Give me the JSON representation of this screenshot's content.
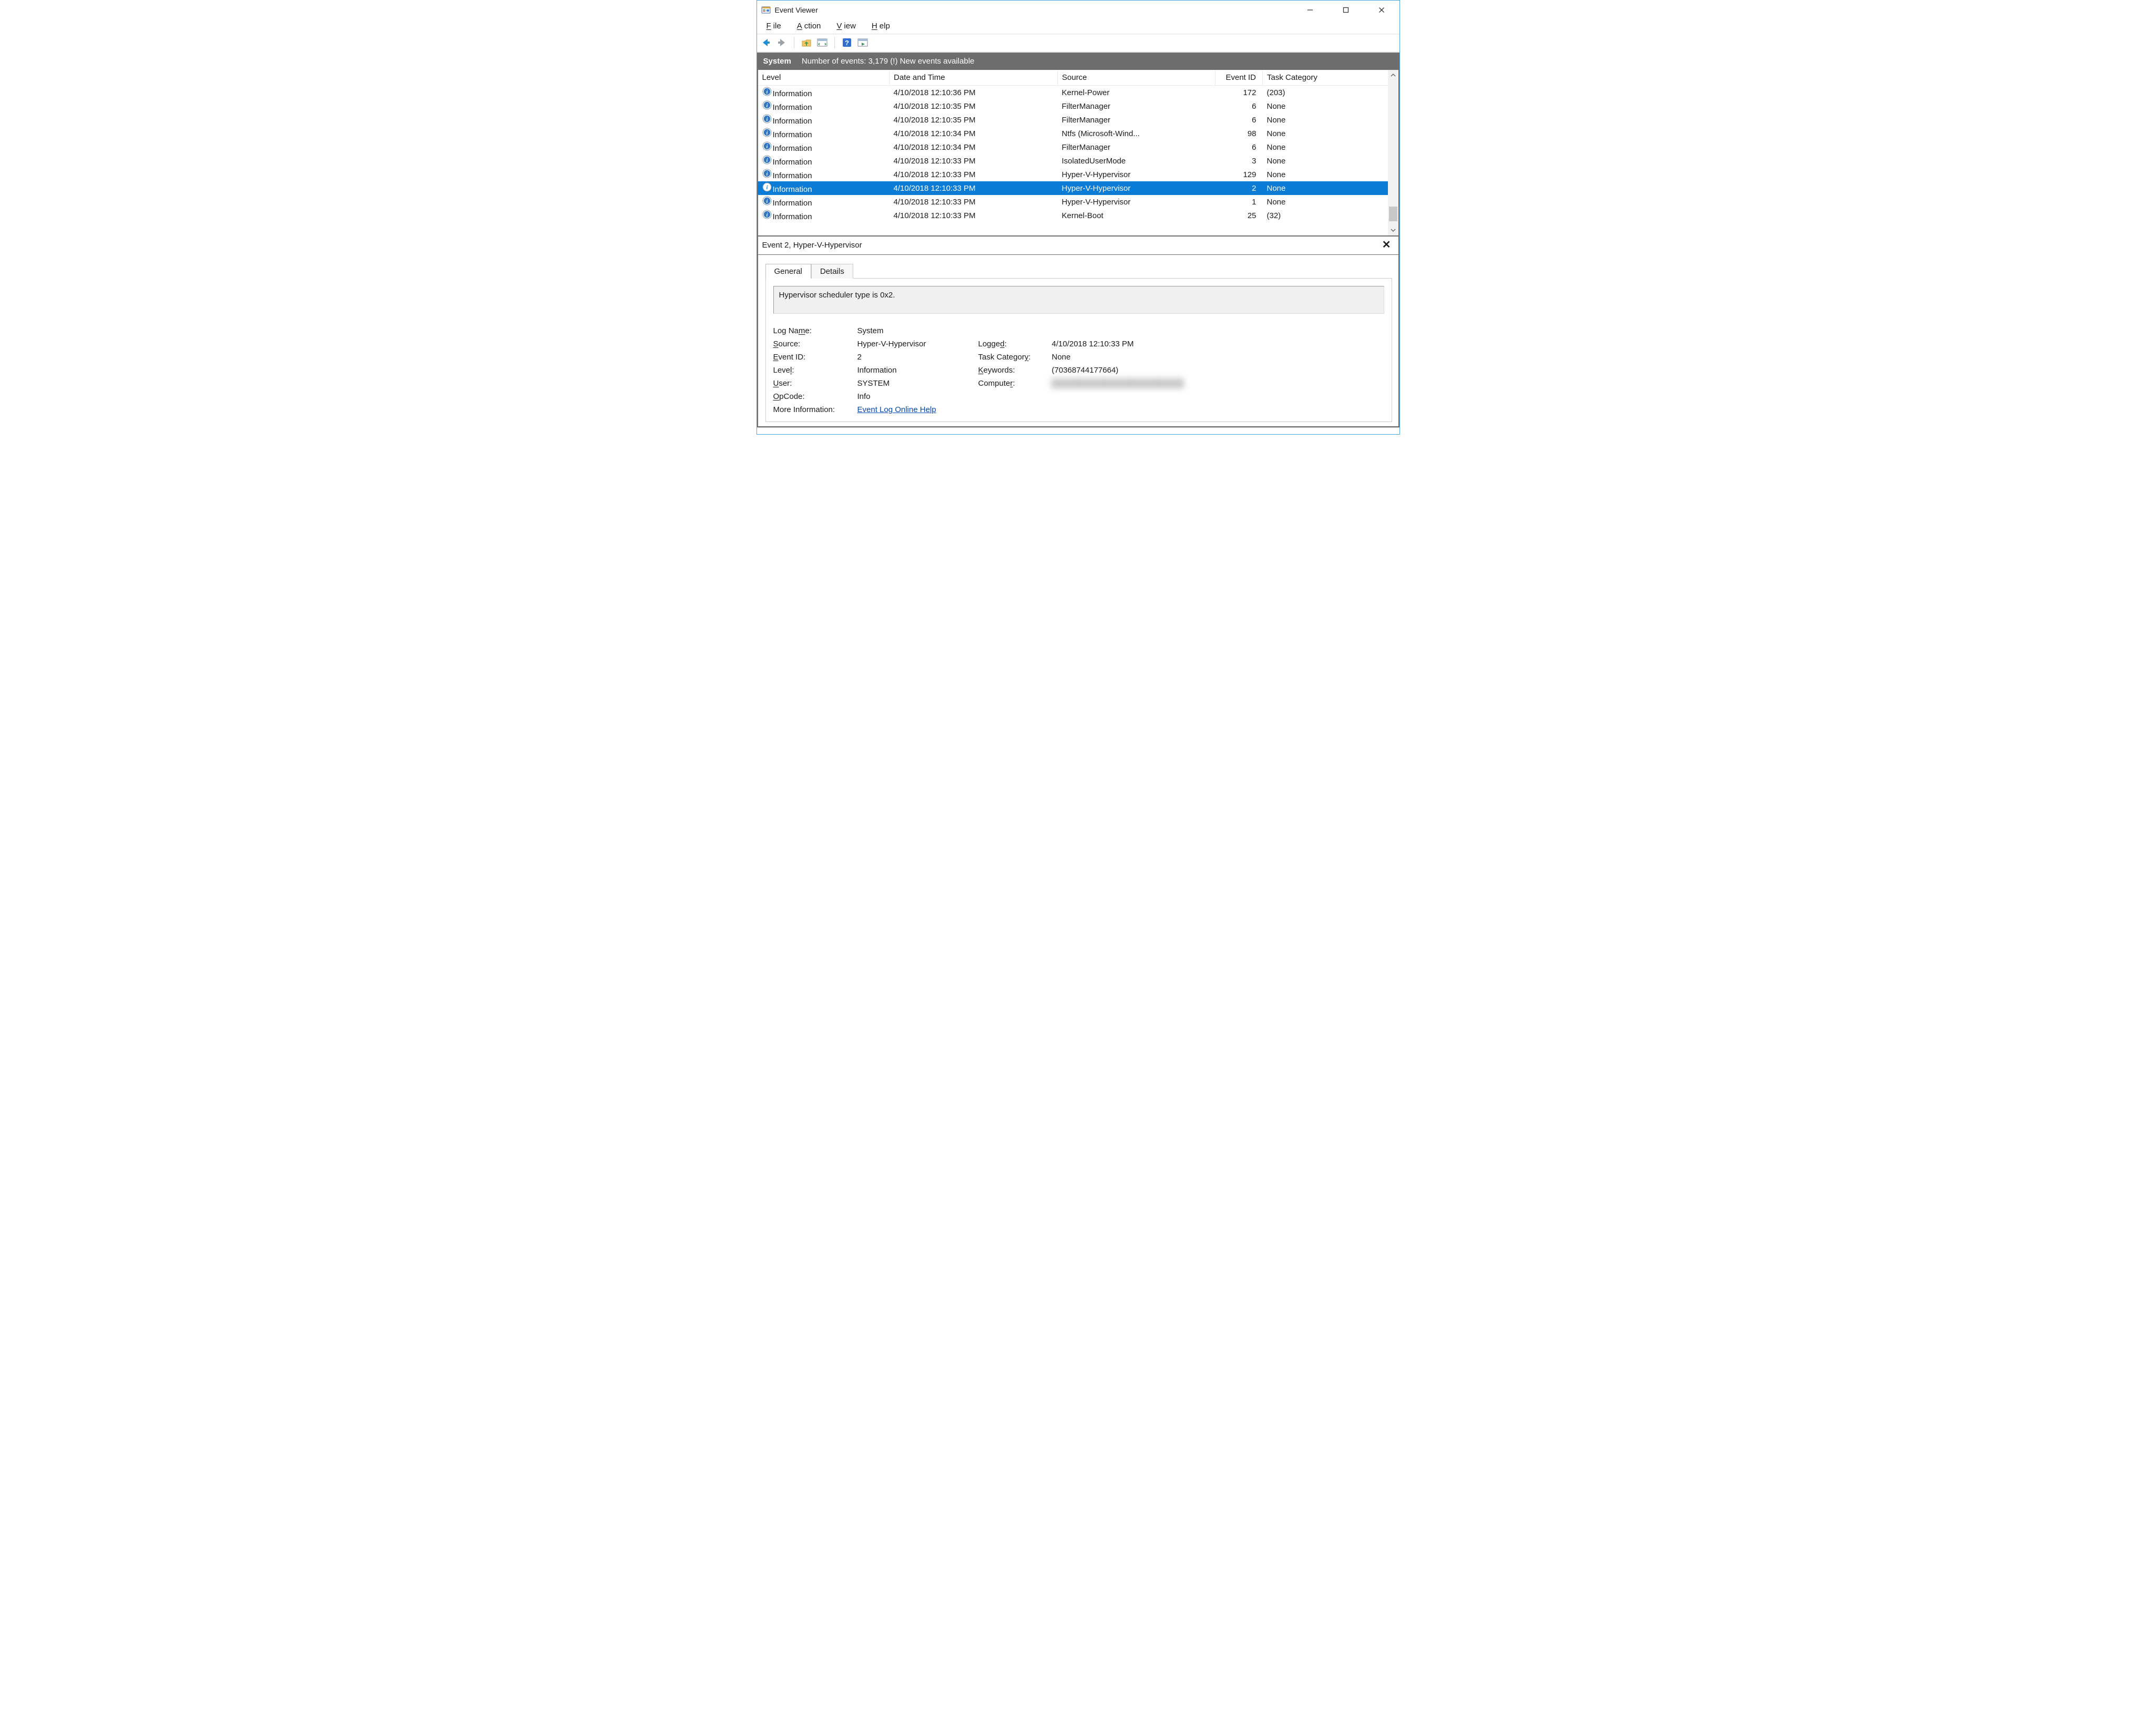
{
  "window": {
    "title": "Event Viewer"
  },
  "menubar": {
    "file": "File",
    "file_u": "F",
    "action": "Action",
    "action_u": "A",
    "view": "View",
    "view_u": "V",
    "help": "Help",
    "help_u": "H"
  },
  "log_header": {
    "name": "System",
    "status": "Number of events: 3,179 (!) New events available"
  },
  "columns": {
    "level": "Level",
    "date": "Date and Time",
    "source": "Source",
    "event_id": "Event ID",
    "task_cat": "Task Category"
  },
  "events": [
    {
      "level": "Information",
      "date": "4/10/2018 12:10:36 PM",
      "source": "Kernel-Power",
      "id": "172",
      "task": "(203)"
    },
    {
      "level": "Information",
      "date": "4/10/2018 12:10:35 PM",
      "source": "FilterManager",
      "id": "6",
      "task": "None"
    },
    {
      "level": "Information",
      "date": "4/10/2018 12:10:35 PM",
      "source": "FilterManager",
      "id": "6",
      "task": "None"
    },
    {
      "level": "Information",
      "date": "4/10/2018 12:10:34 PM",
      "source": "Ntfs (Microsoft-Wind...",
      "id": "98",
      "task": "None"
    },
    {
      "level": "Information",
      "date": "4/10/2018 12:10:34 PM",
      "source": "FilterManager",
      "id": "6",
      "task": "None"
    },
    {
      "level": "Information",
      "date": "4/10/2018 12:10:33 PM",
      "source": "IsolatedUserMode",
      "id": "3",
      "task": "None"
    },
    {
      "level": "Information",
      "date": "4/10/2018 12:10:33 PM",
      "source": "Hyper-V-Hypervisor",
      "id": "129",
      "task": "None"
    },
    {
      "level": "Information",
      "date": "4/10/2018 12:10:33 PM",
      "source": "Hyper-V-Hypervisor",
      "id": "2",
      "task": "None",
      "selected": true
    },
    {
      "level": "Information",
      "date": "4/10/2018 12:10:33 PM",
      "source": "Hyper-V-Hypervisor",
      "id": "1",
      "task": "None"
    },
    {
      "level": "Information",
      "date": "4/10/2018 12:10:33 PM",
      "source": "Kernel-Boot",
      "id": "25",
      "task": "(32)"
    }
  ],
  "details": {
    "title": "Event 2, Hyper-V-Hypervisor",
    "tabs": {
      "general": "General",
      "details": "Details"
    },
    "message": "Hypervisor scheduler type is 0x2.",
    "labels": {
      "log_name": "Log Name:",
      "log_name_u": "m",
      "source": "Source:",
      "source_u": "S",
      "event_id": "Event ID:",
      "event_id_u": "E",
      "level": "Level:",
      "level_u": "l",
      "user": "User:",
      "user_u": "U",
      "opcode": "OpCode:",
      "opcode_u": "O",
      "more": "More Information:",
      "logged": "Logged:",
      "logged_u": "d",
      "task_cat": "Task Category:",
      "task_cat_u": "y",
      "keywords": "Keywords:",
      "keywords_u": "K",
      "computer": "Computer:",
      "computer_u": "r"
    },
    "values": {
      "log_name": "System",
      "source": "Hyper-V-Hypervisor",
      "event_id": "2",
      "level": "Information",
      "user": "SYSTEM",
      "opcode": "Info",
      "more_link": "Event Log Online Help",
      "logged": "4/10/2018 12:10:33 PM",
      "task_cat": "None",
      "keywords": "(70368744177664)",
      "computer": "████████████████████"
    }
  }
}
